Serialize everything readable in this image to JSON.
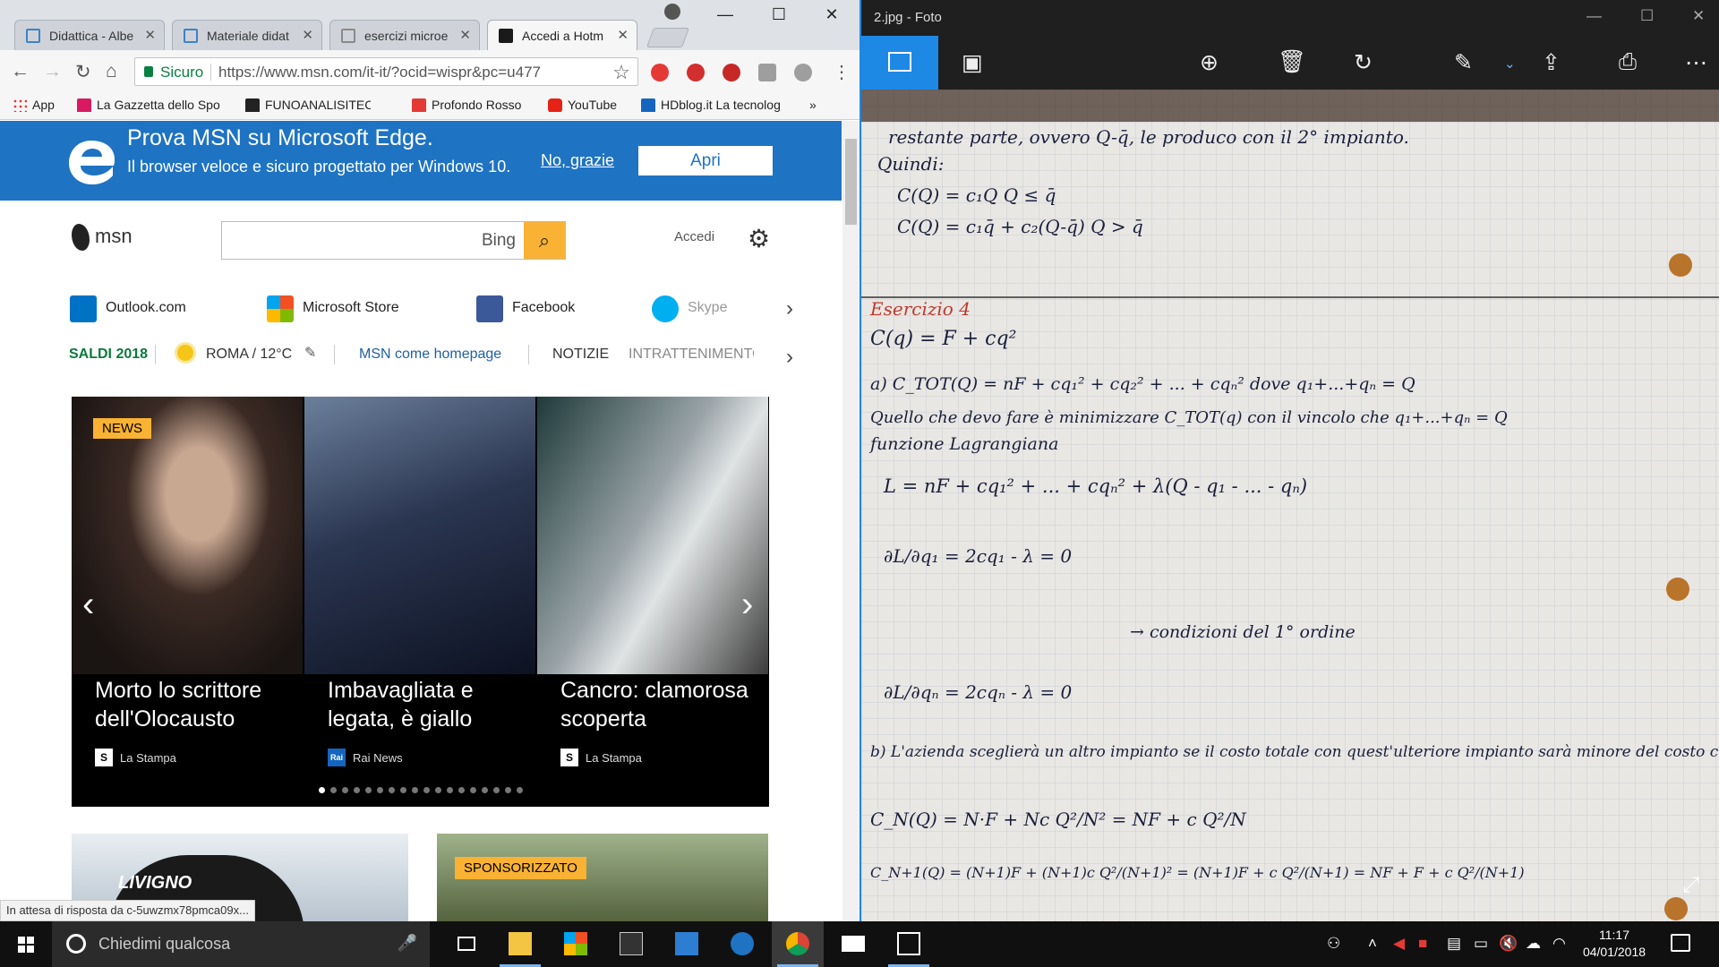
{
  "chrome": {
    "tabs": [
      {
        "label": "Didattica - Albe",
        "icon": "doc-blue"
      },
      {
        "label": "Materiale didat",
        "icon": "doc-blue"
      },
      {
        "label": "esercizi microe",
        "icon": "doc"
      },
      {
        "label": "Accedi a Hotm",
        "icon": "msn"
      }
    ],
    "omnibox": {
      "secure_label": "Sicuro",
      "url": "https://www.msn.com/it-it/?ocid=wispr&pc=u477"
    },
    "bookmarks": [
      {
        "label": "App",
        "color": "#e53935"
      },
      {
        "label": "La Gazzetta dello Spo",
        "color": "#d81b60"
      },
      {
        "label": "FUNOANALISITECNIC",
        "color": "#222222"
      },
      {
        "label": "Profondo Rosso",
        "color": "#e53935"
      },
      {
        "label": "YouTube",
        "color": "#e62117"
      },
      {
        "label": "HDblog.it La tecnolog",
        "color": "#1565c0"
      }
    ],
    "bookmarks_more": "»",
    "status": "In attesa di risposta da c-5uwzmx78pmca09x..."
  },
  "msn": {
    "banner": {
      "title": "Prova MSN su Microsoft Edge.",
      "subtitle": "Il browser veloce e sicuro progettato per Windows 10.",
      "no_thanks": "No, grazie",
      "open": "Apri"
    },
    "logo": "msn",
    "search_engine": "Bing",
    "signin": "Accedi",
    "quicklinks": [
      {
        "label": "Outlook.com",
        "color": "#0072c6"
      },
      {
        "label": "Microsoft Store",
        "color": "#222222"
      },
      {
        "label": "Facebook",
        "color": "#3b5998"
      },
      {
        "label": "Skype",
        "color": "#00aff0"
      }
    ],
    "subnav": {
      "promo": "SALDI 2018",
      "weather": "ROMA / 12°C",
      "homepage": "MSN come homepage",
      "news": "NOTIZIE",
      "entertainment": "INTRATTENIMENTO"
    },
    "carousel": {
      "badge": "NEWS",
      "slides": [
        {
          "caption": "Morto lo scrittore dell'Olocausto",
          "source": "La Stampa",
          "source_icon": "S"
        },
        {
          "caption": "Imbavagliata e legata, è giallo",
          "source": "Rai News",
          "source_icon": "Rai"
        },
        {
          "caption": "Cancro: clamorosa scoperta",
          "source": "La Stampa",
          "source_icon": "S"
        }
      ],
      "dots_total": 18,
      "dot_active": 1
    },
    "cards": {
      "sponsored": "SPONSORIZZATO",
      "helmet_text": "LIVIGNO"
    }
  },
  "photos": {
    "title": "2.jpg - Foto",
    "notes": [
      "restante parte, ovvero Q-q̄, le produco con il 2° impianto.",
      "Quindi:",
      "C(Q) = c₁Q   Q ≤ q̄",
      "C(Q) = c₁q̄ + c₂(Q-q̄)   Q > q̄",
      "Esercizio 4",
      "C(q) = F + cq²",
      "a) C_TOT(Q) = nF + cq₁² + cq₂² + ... + cqₙ²      dove q₁+...+qₙ = Q",
      "Quello che devo fare è minimizzare C_TOT(q) con il vincolo che q₁+...+qₙ = Q",
      "funzione Lagrangiana",
      "L = nF + cq₁² + ... + cqₙ² + λ(Q - q₁ - ... - qₙ)",
      "∂L/∂q₁ = 2cq₁ - λ = 0",
      "→ condizioni del 1° ordine",
      "∂L/∂qₙ = 2cqₙ - λ = 0",
      "b) L'azienda sceglierà un altro impianto se il costo totale con quest'ulteriore impianto sarà minore del costo che già ha.",
      "C_N(Q) = N·F + Nc Q²/N² = NF + c Q²/N",
      "C_N+1(Q) = (N+1)F + (N+1)c Q²/(N+1)² = (N+1)F + c Q²/(N+1) = NF + F + c Q²/(N+1)"
    ]
  },
  "taskbar": {
    "search_placeholder": "Chiedimi qualcosa",
    "time": "11:17",
    "date": "04/01/2018"
  }
}
